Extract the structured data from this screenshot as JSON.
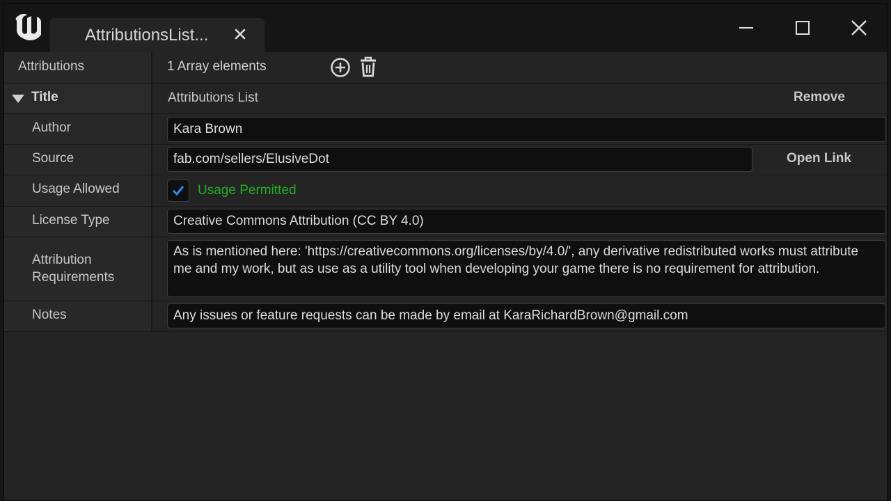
{
  "window": {
    "tab_title": "AttributionsList...",
    "logo_icon": "unreal-engine-logo"
  },
  "attributions": {
    "label": "Attributions",
    "count_text": "1 Array elements"
  },
  "title_row": {
    "label": "Title",
    "value": "Attributions List",
    "remove_label": "Remove"
  },
  "fields": {
    "author": {
      "label": "Author",
      "value": "Kara Brown"
    },
    "source": {
      "label": "Source",
      "value": "fab.com/sellers/ElusiveDot",
      "open_link_label": "Open Link"
    },
    "usage": {
      "label": "Usage Allowed",
      "checked": true,
      "status_text": "Usage Permitted",
      "status_color": "#20b020"
    },
    "license": {
      "label": "License Type",
      "value": "Creative Commons Attribution (CC BY 4.0)"
    },
    "requirements": {
      "label": "Attribution Requirements",
      "value": "As is mentioned here: 'https://creativecommons.org/licenses/by/4.0/', any derivative redistributed works must attribute me and my work, but as use as a utility tool when developing your game there is no requirement for attribution."
    },
    "notes": {
      "label": "Notes",
      "value": "Any issues or feature requests can be made by email at KaraRichardBrown@gmail.com"
    }
  },
  "colors": {
    "accent_blue": "#2a8cf0",
    "background": "#242424",
    "titlebar": "#151515"
  }
}
